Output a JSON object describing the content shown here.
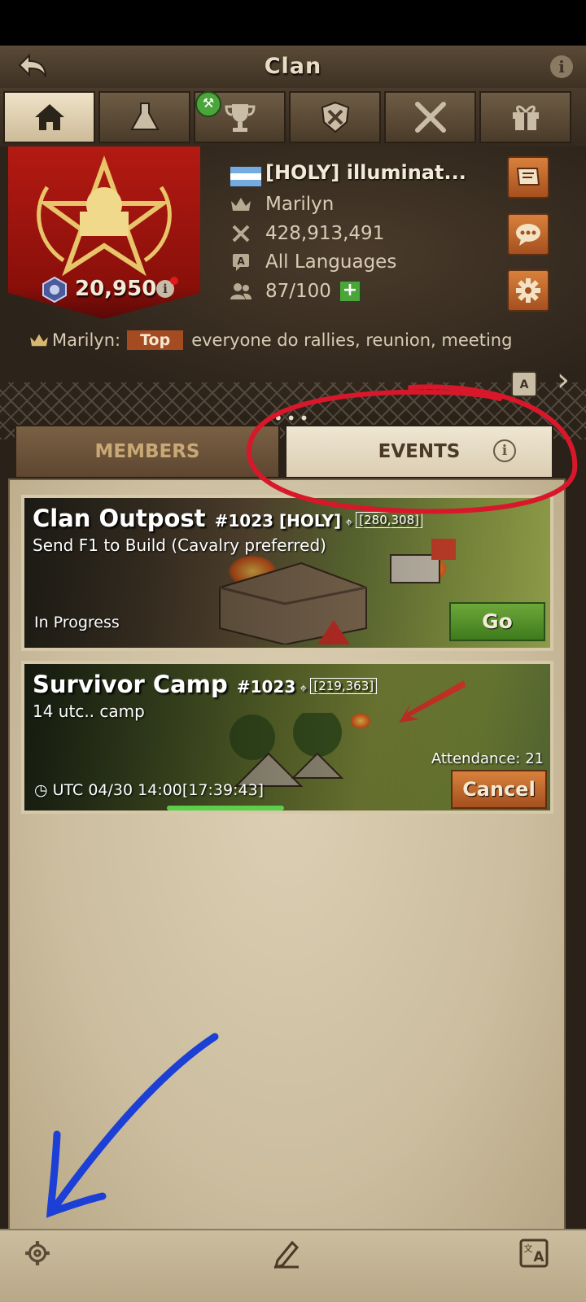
{
  "app": {
    "title": "Clan"
  },
  "tabs": [
    {
      "icon": "home-icon",
      "active": true
    },
    {
      "icon": "flask-icon",
      "active": false
    },
    {
      "icon": "trophy-icon",
      "active": false
    },
    {
      "icon": "shield-tools-icon",
      "active": false
    },
    {
      "icon": "crossed-swords-icon",
      "active": false
    },
    {
      "icon": "gift-icon",
      "active": false
    }
  ],
  "clan": {
    "power": "20,950",
    "name": "[HOLY] illuminat...",
    "leader": "Marilyn",
    "kills": "428,913,491",
    "language": "All Languages",
    "members": "87/100"
  },
  "announcement": {
    "author": "Marilyn:",
    "badge": "Top",
    "text": "everyone do rallies, reunion, meeting"
  },
  "segments": {
    "members": "MEMBERS",
    "events": "EVENTS"
  },
  "events": [
    {
      "title": "Clan Outpost",
      "server": "#1023 [HOLY]",
      "coords": "[280,308]",
      "description": "Send F1 to Build (Cavalry preferred)",
      "status": "In Progress",
      "action": "Go"
    },
    {
      "title": "Survivor Camp",
      "server": "#1023",
      "coords": "[219,363]",
      "description": "14 utc.. camp",
      "time": "UTC 04/30 14:00",
      "countdown": "[17:39:43]",
      "attendance": "Attendance: 21",
      "action": "Cancel"
    }
  ],
  "colors": {
    "accent_orange": "#c2672c",
    "accent_green": "#5a9a2e",
    "banner_red": "#a8150f",
    "annotation_red": "#d8182a",
    "annotation_blue": "#1c3fd6",
    "annotation_green": "#5ad04a"
  }
}
